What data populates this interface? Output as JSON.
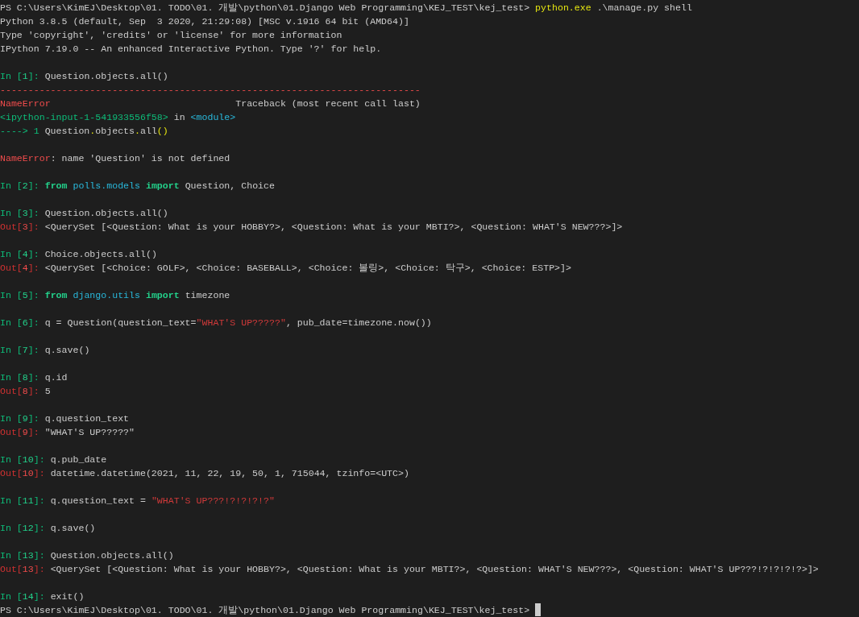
{
  "terminal": {
    "lines": [
      {
        "blank_before": false,
        "segments": [
          {
            "kind": "plain",
            "text": "PS C:\\Users\\KimEJ\\Desktop\\01. TODO\\01. 개발\\python\\01.Django Web Programming\\KEJ_TEST\\kej_test> "
          },
          {
            "kind": "command",
            "text": "python.exe"
          },
          {
            "kind": "plain",
            "text": " .\\manage.py shell"
          }
        ]
      },
      {
        "blank_before": false,
        "segments": [
          {
            "kind": "plain",
            "text": "Python 3.8.5 (default, Sep  3 2020, 21:29:08) [MSC v.1916 64 bit (AMD64)]"
          }
        ]
      },
      {
        "blank_before": false,
        "segments": [
          {
            "kind": "plain",
            "text": "Type 'copyright', 'credits' or 'license' for more information"
          }
        ]
      },
      {
        "blank_before": false,
        "segments": [
          {
            "kind": "plain",
            "text": "IPython 7.19.0 -- An enhanced Interactive Python. Type '?' for help."
          }
        ]
      },
      {
        "blank_before": true,
        "segments": [
          {
            "kind": "in",
            "text": "In ["
          },
          {
            "kind": "in_num",
            "text": "1"
          },
          {
            "kind": "in",
            "text": "]: "
          },
          {
            "kind": "plain",
            "text": "Question.objects.all()"
          }
        ]
      },
      {
        "blank_before": false,
        "segments": [
          {
            "kind": "error",
            "text": "---------------------------------------------------------------------------"
          }
        ]
      },
      {
        "blank_before": false,
        "segments": [
          {
            "kind": "error",
            "text": "NameError"
          },
          {
            "kind": "plain",
            "text": "                                 Traceback (most recent call last)"
          }
        ]
      },
      {
        "blank_before": false,
        "segments": [
          {
            "kind": "in",
            "text": "<ipython-input-1-541933556f58>"
          },
          {
            "kind": "plain",
            "text": " in "
          },
          {
            "kind": "module",
            "text": "<module>"
          }
        ]
      },
      {
        "blank_before": false,
        "segments": [
          {
            "kind": "in",
            "text": "----> 1"
          },
          {
            "kind": "plain",
            "text": " Question"
          },
          {
            "kind": "accent",
            "text": "."
          },
          {
            "kind": "plain",
            "text": "objects"
          },
          {
            "kind": "accent",
            "text": "."
          },
          {
            "kind": "plain",
            "text": "all"
          },
          {
            "kind": "accent",
            "text": "()"
          }
        ]
      },
      {
        "blank_before": true,
        "segments": [
          {
            "kind": "error",
            "text": "NameError"
          },
          {
            "kind": "plain",
            "text": ": name 'Question' is not defined"
          }
        ]
      },
      {
        "blank_before": true,
        "segments": [
          {
            "kind": "in",
            "text": "In ["
          },
          {
            "kind": "in_num",
            "text": "2"
          },
          {
            "kind": "in",
            "text": "]: "
          },
          {
            "kind": "keyword",
            "text": "from"
          },
          {
            "kind": "module",
            "text": " polls.models"
          },
          {
            "kind": "keyword",
            "text": " import"
          },
          {
            "kind": "plain",
            "text": " Question, Choice"
          }
        ]
      },
      {
        "blank_before": true,
        "segments": [
          {
            "kind": "in",
            "text": "In ["
          },
          {
            "kind": "in_num",
            "text": "3"
          },
          {
            "kind": "in",
            "text": "]: "
          },
          {
            "kind": "plain",
            "text": "Question.objects.all()"
          }
        ]
      },
      {
        "blank_before": false,
        "segments": [
          {
            "kind": "out",
            "text": "Out["
          },
          {
            "kind": "out_num",
            "text": "3"
          },
          {
            "kind": "out",
            "text": "]: "
          },
          {
            "kind": "plain",
            "text": "<QuerySet [<Question: What is your HOBBY?>, <Question: What is your MBTI?>, <Question: WHAT'S NEW???>]>"
          }
        ]
      },
      {
        "blank_before": true,
        "segments": [
          {
            "kind": "in",
            "text": "In ["
          },
          {
            "kind": "in_num",
            "text": "4"
          },
          {
            "kind": "in",
            "text": "]: "
          },
          {
            "kind": "plain",
            "text": "Choice.objects.all()"
          }
        ]
      },
      {
        "blank_before": false,
        "segments": [
          {
            "kind": "out",
            "text": "Out["
          },
          {
            "kind": "out_num",
            "text": "4"
          },
          {
            "kind": "out",
            "text": "]: "
          },
          {
            "kind": "plain",
            "text": "<QuerySet [<Choice: GOLF>, <Choice: BASEBALL>, <Choice: 볼링>, <Choice: 탁구>, <Choice: ESTP>]>"
          }
        ]
      },
      {
        "blank_before": true,
        "segments": [
          {
            "kind": "in",
            "text": "In ["
          },
          {
            "kind": "in_num",
            "text": "5"
          },
          {
            "kind": "in",
            "text": "]: "
          },
          {
            "kind": "keyword",
            "text": "from"
          },
          {
            "kind": "module",
            "text": " django.utils"
          },
          {
            "kind": "keyword",
            "text": " import"
          },
          {
            "kind": "plain",
            "text": " timezone"
          }
        ]
      },
      {
        "blank_before": true,
        "segments": [
          {
            "kind": "in",
            "text": "In ["
          },
          {
            "kind": "in_num",
            "text": "6"
          },
          {
            "kind": "in",
            "text": "]: "
          },
          {
            "kind": "plain",
            "text": "q = Question(question_text="
          },
          {
            "kind": "string",
            "text": "\"WHAT'S UP?????\""
          },
          {
            "kind": "plain",
            "text": ", pub_date=timezone.now())"
          }
        ]
      },
      {
        "blank_before": true,
        "segments": [
          {
            "kind": "in",
            "text": "In ["
          },
          {
            "kind": "in_num",
            "text": "7"
          },
          {
            "kind": "in",
            "text": "]: "
          },
          {
            "kind": "plain",
            "text": "q.save()"
          }
        ]
      },
      {
        "blank_before": true,
        "segments": [
          {
            "kind": "in",
            "text": "In ["
          },
          {
            "kind": "in_num",
            "text": "8"
          },
          {
            "kind": "in",
            "text": "]: "
          },
          {
            "kind": "plain",
            "text": "q.id"
          }
        ]
      },
      {
        "blank_before": false,
        "segments": [
          {
            "kind": "out",
            "text": "Out["
          },
          {
            "kind": "out_num",
            "text": "8"
          },
          {
            "kind": "out",
            "text": "]: "
          },
          {
            "kind": "plain",
            "text": "5"
          }
        ]
      },
      {
        "blank_before": true,
        "segments": [
          {
            "kind": "in",
            "text": "In ["
          },
          {
            "kind": "in_num",
            "text": "9"
          },
          {
            "kind": "in",
            "text": "]: "
          },
          {
            "kind": "plain",
            "text": "q.question_text"
          }
        ]
      },
      {
        "blank_before": false,
        "segments": [
          {
            "kind": "out",
            "text": "Out["
          },
          {
            "kind": "out_num",
            "text": "9"
          },
          {
            "kind": "out",
            "text": "]: "
          },
          {
            "kind": "plain",
            "text": "\"WHAT'S UP?????\""
          }
        ]
      },
      {
        "blank_before": true,
        "segments": [
          {
            "kind": "in",
            "text": "In ["
          },
          {
            "kind": "in_num",
            "text": "10"
          },
          {
            "kind": "in",
            "text": "]: "
          },
          {
            "kind": "plain",
            "text": "q.pub_date"
          }
        ]
      },
      {
        "blank_before": false,
        "segments": [
          {
            "kind": "out",
            "text": "Out["
          },
          {
            "kind": "out_num",
            "text": "10"
          },
          {
            "kind": "out",
            "text": "]: "
          },
          {
            "kind": "plain",
            "text": "datetime.datetime(2021, 11, 22, 19, 50, 1, 715044, tzinfo=<UTC>)"
          }
        ]
      },
      {
        "blank_before": true,
        "segments": [
          {
            "kind": "in",
            "text": "In ["
          },
          {
            "kind": "in_num",
            "text": "11"
          },
          {
            "kind": "in",
            "text": "]: "
          },
          {
            "kind": "plain",
            "text": "q.question_text = "
          },
          {
            "kind": "string",
            "text": "\"WHAT'S UP???!?!?!?!?\""
          }
        ]
      },
      {
        "blank_before": true,
        "segments": [
          {
            "kind": "in",
            "text": "In ["
          },
          {
            "kind": "in_num",
            "text": "12"
          },
          {
            "kind": "in",
            "text": "]: "
          },
          {
            "kind": "plain",
            "text": "q.save()"
          }
        ]
      },
      {
        "blank_before": true,
        "segments": [
          {
            "kind": "in",
            "text": "In ["
          },
          {
            "kind": "in_num",
            "text": "13"
          },
          {
            "kind": "in",
            "text": "]: "
          },
          {
            "kind": "plain",
            "text": "Question.objects.all()"
          }
        ]
      },
      {
        "blank_before": false,
        "segments": [
          {
            "kind": "out",
            "text": "Out["
          },
          {
            "kind": "out_num",
            "text": "13"
          },
          {
            "kind": "out",
            "text": "]: "
          },
          {
            "kind": "plain",
            "text": "<QuerySet [<Question: What is your HOBBY?>, <Question: What is your MBTI?>, <Question: WHAT'S NEW???>, <Question: WHAT'S UP???!?!?!?!?>]>"
          }
        ]
      },
      {
        "blank_before": true,
        "segments": [
          {
            "kind": "in",
            "text": "In ["
          },
          {
            "kind": "in_num",
            "text": "14"
          },
          {
            "kind": "in",
            "text": "]: "
          },
          {
            "kind": "plain",
            "text": "exit()"
          }
        ]
      },
      {
        "blank_before": false,
        "cursor": true,
        "segments": [
          {
            "kind": "plain",
            "text": "PS C:\\Users\\KimEJ\\Desktop\\01. TODO\\01. 개발\\python\\01.Django Web Programming\\KEJ_TEST\\kej_test> "
          }
        ]
      }
    ]
  }
}
